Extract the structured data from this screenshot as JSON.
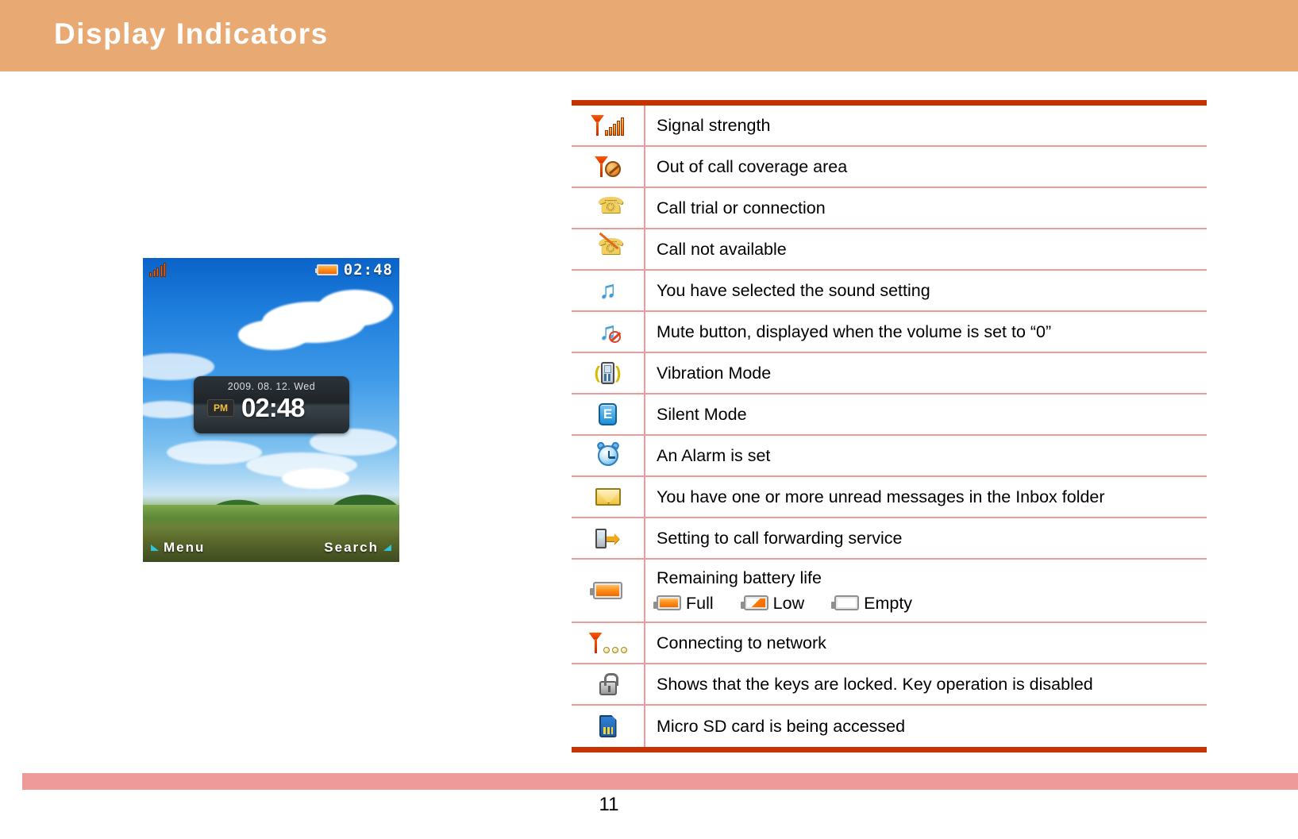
{
  "header": {
    "title": "Display Indicators",
    "background_color": "#E8A972",
    "text_color": "#FFFFFF"
  },
  "phone_preview": {
    "status_bar": {
      "signal_icon": "signal-strength-icon",
      "battery_icon": "battery-full-icon",
      "clock": "02:48"
    },
    "clock_widget": {
      "date": "2009. 08. 12.  Wed",
      "ampm": "PM",
      "time": "02:48"
    },
    "softkeys": {
      "left_label": "Menu",
      "right_label": "Search"
    }
  },
  "indicator_table": {
    "border_color": "#C63300",
    "divider_color": "#EE9A9A",
    "rows": [
      {
        "icon": "signal-strength-icon",
        "text": "Signal strength"
      },
      {
        "icon": "out-of-coverage-icon",
        "text": "Out of call coverage area"
      },
      {
        "icon": "call-active-icon",
        "text": "Call trial or connection"
      },
      {
        "icon": "call-unavailable-icon",
        "text": "Call not available"
      },
      {
        "icon": "sound-note-icon",
        "text": "You have selected the sound setting"
      },
      {
        "icon": "mute-icon",
        "text": "Mute button, displayed when the volume is set to “0”"
      },
      {
        "icon": "vibration-icon",
        "text": "Vibration Mode"
      },
      {
        "icon": "silent-mode-icon",
        "text": "Silent Mode"
      },
      {
        "icon": "alarm-clock-icon",
        "text": "An Alarm is set"
      },
      {
        "icon": "envelope-icon",
        "text": "You have one or more unread messages in the Inbox folder"
      },
      {
        "icon": "call-forwarding-icon",
        "text": "Setting to call forwarding service"
      },
      {
        "icon": "battery-icon",
        "text": "Remaining battery life"
      },
      {
        "icon": "connecting-network-icon",
        "text": "Connecting  to network"
      },
      {
        "icon": "key-lock-icon",
        "text": "Shows that the keys are locked. Key operation is disabled"
      },
      {
        "icon": "micro-sd-icon",
        "text": "Micro SD card is being accessed"
      }
    ],
    "battery_levels": [
      {
        "icon": "battery-full-icon",
        "label": "Full"
      },
      {
        "icon": "battery-low-icon",
        "label": "Low"
      },
      {
        "icon": "battery-empty-icon",
        "label": "Empty"
      }
    ]
  },
  "footer": {
    "page_number": "11",
    "bar_color": "#EE9A9A"
  }
}
